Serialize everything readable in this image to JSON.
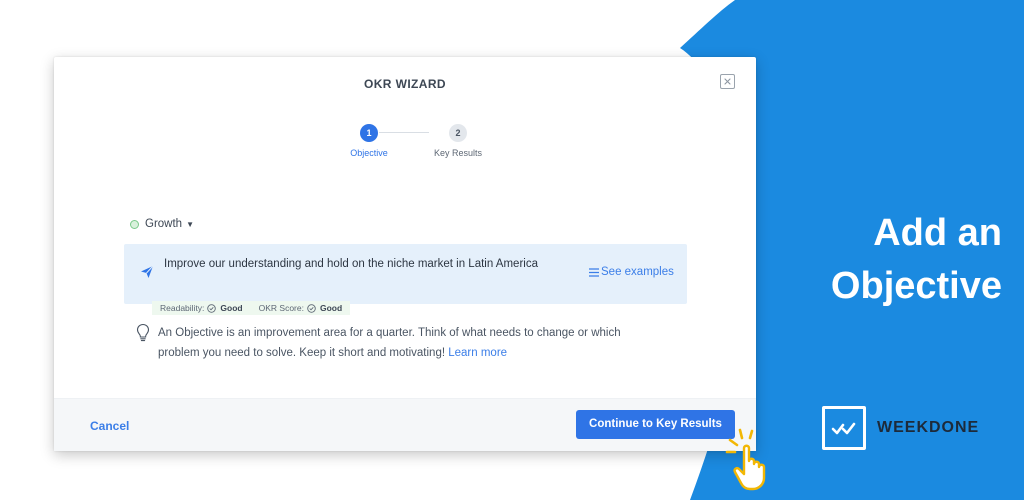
{
  "promo": {
    "title_line1": "Add an",
    "title_line2": "Objective",
    "brand_name": "WEEKDONE"
  },
  "wizard": {
    "title": "OKR WIZARD",
    "steps": [
      {
        "number": "1",
        "label": "Objective",
        "active": true
      },
      {
        "number": "2",
        "label": "Key Results",
        "active": false
      }
    ],
    "tag": {
      "label": "Growth",
      "icon": "growth-dot-icon"
    },
    "objective_text": "Improve our understanding and hold on the niche market in Latin America",
    "see_examples_label": "See examples",
    "scores": {
      "readability_label": "Readability:",
      "readability_value": "Good",
      "okr_score_label": "OKR Score:",
      "okr_score_value": "Good"
    },
    "hint_text": "An Objective is an improvement area for a quarter. Think of what needs to change or which problem you need to solve. Keep it short and motivating!",
    "learn_more_label": "Learn more",
    "cancel_label": "Cancel",
    "continue_label": "Continue to Key Results"
  },
  "colors": {
    "brand_blue": "#1b8ae0",
    "primary_button": "#2f74e6",
    "link_blue": "#3b7ee8",
    "objective_bg": "#e5f0fb",
    "cursor_yellow": "#f2b705"
  }
}
